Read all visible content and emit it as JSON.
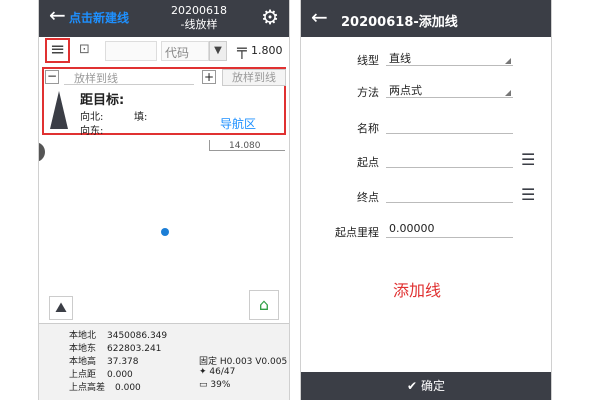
{
  "left": {
    "header": {
      "back_icon": "←",
      "annotation_new_line": "点击新建线",
      "title_line1": "20200618",
      "title_line2": "-线放样",
      "gear_icon": "⚙"
    },
    "toolbar": {
      "menu_icon": "≡",
      "image_icon": "⊡",
      "code_placeholder": "代码",
      "dropdown_icon": "▼",
      "pole_icon": "╤",
      "pole_height": "1.800"
    },
    "navigation": {
      "minus": "−",
      "target_placeholder": "放样到线",
      "plus": "+",
      "stake_button": "放样到线",
      "distance_label": "距目标:",
      "north_label": "向北:",
      "fill_label": "填:",
      "east_label": "向东:",
      "annotation_nav_area": "导航区"
    },
    "scale": {
      "label": "14.080"
    },
    "status": {
      "local_north_label": "本地北",
      "local_north": "3450086.349",
      "local_east_label": "本地东",
      "local_east": "622803.241",
      "local_height_label": "本地高",
      "local_height": "37.378",
      "prev_dist_label": "上点距",
      "prev_dist": "0.000",
      "prev_height_diff_label": "上点高差",
      "prev_height_diff": "0.000",
      "fix_status": "固定 H0.003 V0.005",
      "satellites": "46/47",
      "battery": "39%"
    }
  },
  "right": {
    "header": {
      "back_icon": "←",
      "title": "20200618-添加线"
    },
    "form": {
      "line_type_label": "线型",
      "line_type_value": "直线",
      "method_label": "方法",
      "method_value": "两点式",
      "name_label": "名称",
      "name_value": "",
      "start_label": "起点",
      "start_value": "",
      "end_label": "终点",
      "end_value": "",
      "start_mileage_label": "起点里程",
      "start_mileage_value": "0.00000"
    },
    "annotation_add_line": "添加线",
    "confirm_icon": "✔",
    "confirm_label": "确定"
  }
}
